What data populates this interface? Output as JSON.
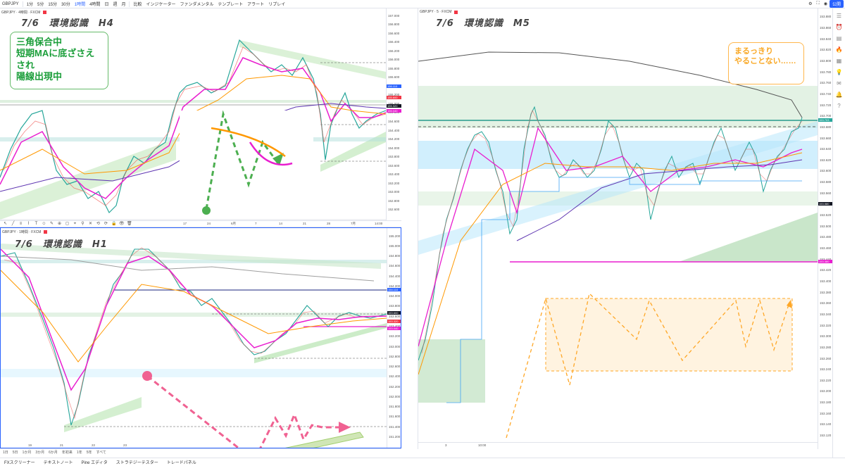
{
  "toolbar": {
    "symbol": "GBPJPY",
    "timeframes": [
      "1分",
      "5分",
      "15分",
      "30分",
      "1時間",
      "4時間",
      "日",
      "週",
      "月"
    ],
    "selected_timeframe": "1時間",
    "items": [
      "比較",
      "インジケーター",
      "ファンダメンタル",
      "テンプレート",
      "アラート",
      "リプレイ"
    ],
    "publish": "公開"
  },
  "panes": {
    "h4": {
      "header": "GBPJPY · 4時間 · FXCM",
      "title": "7/6　環境認識　H4",
      "note": [
        "三角保合中",
        "短期MAに底ざさえされ",
        "陽線出現中"
      ],
      "price_labels": [
        "157.000",
        "156.800",
        "156.600",
        "156.400",
        "156.200",
        "156.000",
        "155.800",
        "155.600",
        "155.400",
        "155.200",
        "155.000",
        "154.800",
        "154.600",
        "154.400",
        "154.200",
        "154.000",
        "153.800",
        "153.600",
        "153.400",
        "153.200",
        "153.000",
        "152.800",
        "152.600"
      ],
      "tags": [
        {
          "text": "156.110",
          "color": "#2962ff"
        },
        {
          "text": "155.600",
          "color": "#f23645"
        },
        {
          "text": "155.320",
          "color": "#131722"
        },
        {
          "text": "155.040",
          "color": "#e91ecf"
        }
      ],
      "time_labels": [
        "17",
        "24",
        "6月",
        "7",
        "14",
        "21",
        "28",
        "7月",
        "14:00"
      ]
    },
    "h1": {
      "header": "GBPJPY · 1時間 · FXCM",
      "title": "7/6　環境認識　H1",
      "price_labels": [
        "155.200",
        "155.000",
        "154.800",
        "154.600",
        "154.400",
        "154.200",
        "154.000",
        "153.800",
        "153.600",
        "153.400",
        "153.200",
        "153.000",
        "152.800",
        "152.600",
        "152.400",
        "152.200",
        "152.000",
        "151.800",
        "151.600",
        "151.400",
        "151.200"
      ],
      "tags": [
        {
          "text": "154.110",
          "color": "#2962ff"
        },
        {
          "text": "153.600",
          "color": "#131722"
        },
        {
          "text": "153.320",
          "color": "#f23645"
        },
        {
          "text": "153.040",
          "color": "#e91ecf"
        }
      ],
      "time_labels": [
        "19",
        "21",
        "22",
        "23"
      ]
    },
    "m5": {
      "header": "GBPJPY · 5 · FXCM",
      "title": "7/6　環境認識　M5",
      "note": [
        "まるっきり",
        "やることない……"
      ],
      "price_labels": [
        "153.880",
        "153.860",
        "153.840",
        "153.820",
        "153.800",
        "153.780",
        "153.760",
        "153.740",
        "153.720",
        "153.700",
        "153.680",
        "153.660",
        "153.640",
        "153.620",
        "153.600",
        "153.580",
        "153.560",
        "153.540",
        "153.520",
        "153.500",
        "153.480",
        "153.460",
        "153.440",
        "153.420",
        "153.400",
        "153.380",
        "153.360",
        "153.340",
        "153.320",
        "153.300",
        "153.280",
        "153.260",
        "153.240",
        "153.220",
        "153.200",
        "153.180",
        "153.160",
        "153.140",
        "153.120"
      ],
      "tags": [
        {
          "text": "153.703",
          "color": "#26a69a"
        },
        {
          "text": "153.580",
          "color": "#131722"
        },
        {
          "text": "153.380",
          "color": "#e91ecf"
        }
      ],
      "time_labels": [
        "3",
        "10:00"
      ]
    }
  },
  "drawing_tools": [
    "↖",
    "╱",
    "≡",
    "⌇",
    "T",
    "☺",
    "✎",
    "⊕",
    "◻",
    "⌖",
    "⚲",
    "✕",
    "⟲",
    "⟳",
    "🔒",
    "👁",
    "🗑"
  ],
  "range_bar": [
    "1日",
    "5日",
    "1か月",
    "3か月",
    "6か月",
    "年初来",
    "1年",
    "5年",
    "すべて"
  ],
  "bottom_tabs": [
    "FXスクリーナー",
    "テキストノート",
    "Pine エディタ",
    "ストラテジーテスター",
    "トレードパネル"
  ]
}
